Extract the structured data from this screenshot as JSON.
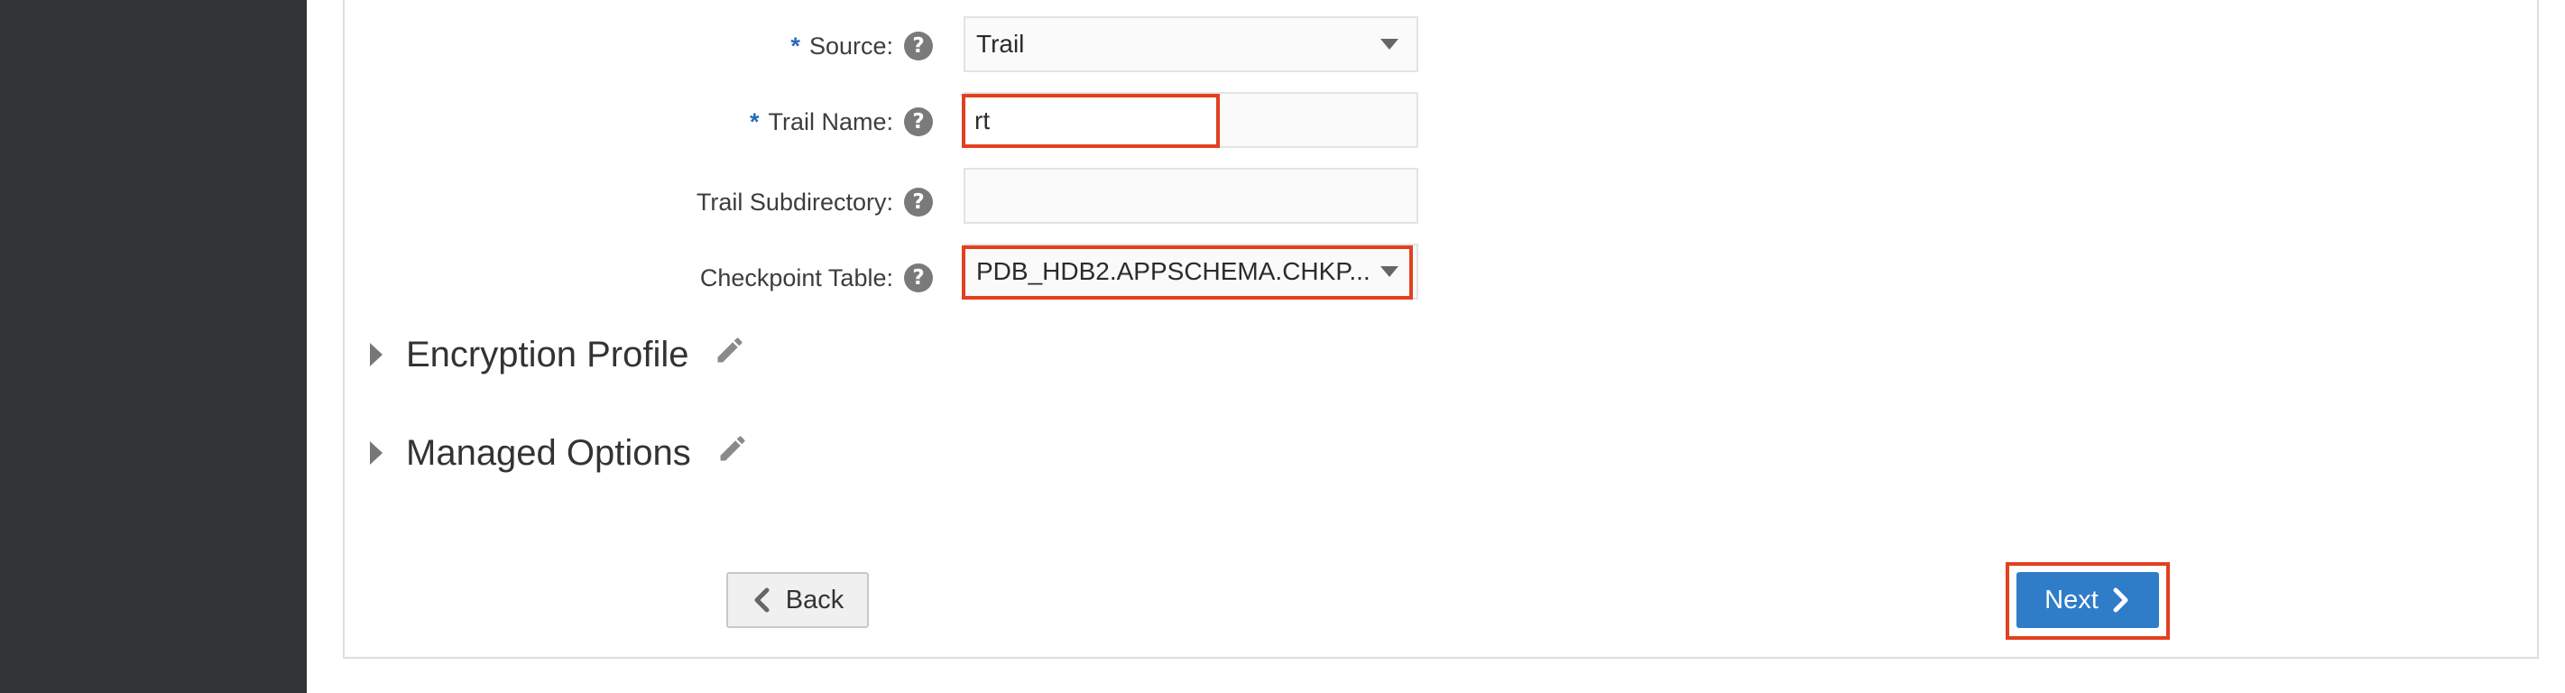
{
  "form": {
    "source": {
      "required_mark": "*",
      "label": "Source:",
      "help": "?",
      "value": "Trail"
    },
    "trail_name": {
      "required_mark": "*",
      "label": "Trail Name:",
      "help": "?",
      "value": "rt"
    },
    "trail_subdirectory": {
      "label": "Trail Subdirectory:",
      "help": "?",
      "value": ""
    },
    "checkpoint_table": {
      "label": "Checkpoint Table:",
      "help": "?",
      "value": "PDB_HDB2.APPSCHEMA.CHKP..."
    }
  },
  "sections": {
    "encryption_profile": {
      "title": "Encryption Profile",
      "icon": "pencil-icon",
      "expand_icon": "triangle-right-icon"
    },
    "managed_options": {
      "title": "Managed Options",
      "icon": "pencil-icon",
      "expand_icon": "triangle-right-icon"
    }
  },
  "buttons": {
    "back_label": "Back",
    "next_label": "Next"
  },
  "colors": {
    "sidebar": "#333436",
    "required": "#2a6bb8",
    "highlight": "#e2401f",
    "primary": "#2f7cc9"
  }
}
